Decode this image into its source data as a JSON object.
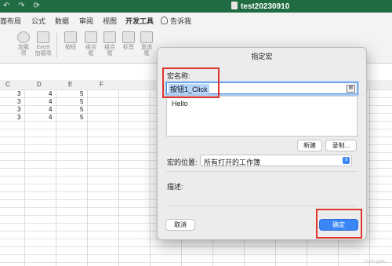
{
  "window": {
    "qat_icons": "↶ ↷ ⟳",
    "doc_title": "test20230910"
  },
  "ribbon_tabs": [
    {
      "label": "面布局"
    },
    {
      "label": "公式"
    },
    {
      "label": "数据"
    },
    {
      "label": "审阅"
    },
    {
      "label": "视图"
    },
    {
      "label": "开发工具"
    },
    {
      "label": "告诉我"
    }
  ],
  "ribbon_buttons": [
    {
      "label": "加载\n项"
    },
    {
      "label": "Excel\n加载项"
    },
    {
      "label": "按钮"
    },
    {
      "label": "组合\n框"
    },
    {
      "label": "组合\n框"
    },
    {
      "label": "标签"
    },
    {
      "label": "复选\n框"
    }
  ],
  "sheet": {
    "columns": [
      "C",
      "D",
      "E",
      "F"
    ],
    "rows": [
      [
        "3",
        "4",
        "5"
      ],
      [
        "3",
        "4",
        "5"
      ],
      [
        "3",
        "4",
        "5"
      ],
      [
        "3",
        "4",
        "5"
      ]
    ]
  },
  "dialog": {
    "title": "指定宏",
    "name_label": "宏名称:",
    "name_value": "按钮1_Click",
    "macro_list": [
      "Hello"
    ],
    "new_button": "新建",
    "record_button": "录制...",
    "location_label": "宏的位置:",
    "location_value": "所有打开的工作簿",
    "description_label": "描述:",
    "cancel_button": "取消",
    "ok_button": "确定"
  },
  "colors": {
    "title_bar": "#1f6c42",
    "primary_button": "#3b86f7",
    "highlight": "#e0352b"
  },
  "watermark": "CSDN @Wo..."
}
